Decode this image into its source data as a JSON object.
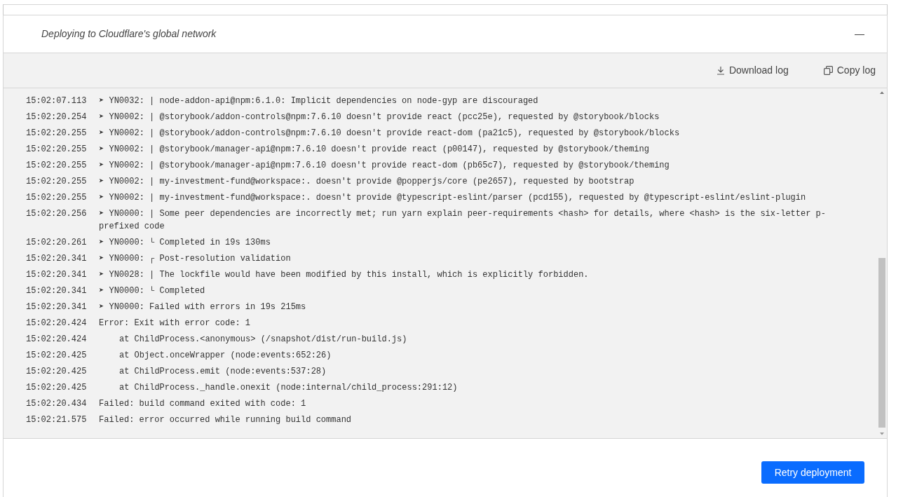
{
  "header": {
    "title": "Deploying to Cloudflare's global network",
    "collapse": "—",
    "expanded": true
  },
  "toolbar": {
    "download": "Download log",
    "copy": "Copy log"
  },
  "log": [
    {
      "time": "15:02:07.113",
      "message": "➤ YN0032: | node-addon-api@npm:6.1.0: Implicit dependencies on node-gyp are discouraged",
      "kind": "line"
    },
    {
      "time": "15:02:20.254",
      "message": "➤ YN0002: | @storybook/addon-controls@npm:7.6.10 doesn't provide react (pcc25e), requested by @storybook/blocks",
      "kind": "line"
    },
    {
      "time": "15:02:20.255",
      "message": "➤ YN0002: | @storybook/addon-controls@npm:7.6.10 doesn't provide react-dom (pa21c5), requested by @storybook/blocks",
      "kind": "line"
    },
    {
      "time": "15:02:20.255",
      "message": "➤ YN0002: | @storybook/manager-api@npm:7.6.10 doesn't provide react (p00147), requested by @storybook/theming",
      "kind": "line"
    },
    {
      "time": "15:02:20.255",
      "message": "➤ YN0002: | @storybook/manager-api@npm:7.6.10 doesn't provide react-dom (pb65c7), requested by @storybook/theming",
      "kind": "line"
    },
    {
      "time": "15:02:20.255",
      "message": "➤ YN0002: | my-investment-fund@workspace:. doesn't provide @popperjs/core (pe2657), requested by bootstrap",
      "kind": "line"
    },
    {
      "time": "15:02:20.255",
      "message": "➤ YN0002: | my-investment-fund@workspace:. doesn't provide @typescript-eslint/parser (pcd155), requested by @typescript-eslint/eslint-plugin",
      "kind": "line"
    },
    {
      "time": "15:02:20.256",
      "message": "➤ YN0000: | Some peer dependencies are incorrectly met; run yarn explain peer-requirements <hash> for details, where <hash> is the six-letter p-prefixed code",
      "kind": "line"
    },
    {
      "time": "15:02:20.261",
      "message": "➤ YN0000: └ Completed in 19s 130ms",
      "kind": "line"
    },
    {
      "time": "15:02:20.341",
      "message": "➤ YN0000: ┌ Post-resolution validation",
      "kind": "line"
    },
    {
      "time": "15:02:20.341",
      "message": "➤ YN0028: | The lockfile would have been modified by this install, which is explicitly forbidden.",
      "kind": "line"
    },
    {
      "time": "15:02:20.341",
      "message": "➤ YN0000: └ Completed",
      "kind": "line"
    },
    {
      "time": "15:02:20.341",
      "message": "➤ YN0000: Failed with errors in 19s 215ms",
      "kind": "line"
    },
    {
      "time": "15:02:20.424",
      "message": "Error: Exit with error code: 1",
      "kind": "line"
    },
    {
      "time": "15:02:20.424",
      "message": "at ChildProcess.<anonymous> (/snapshot/dist/run-build.js)",
      "kind": "stack"
    },
    {
      "time": "15:02:20.425",
      "message": "at Object.onceWrapper (node:events:652:26)",
      "kind": "stack"
    },
    {
      "time": "15:02:20.425",
      "message": "at ChildProcess.emit (node:events:537:28)",
      "kind": "stack"
    },
    {
      "time": "15:02:20.425",
      "message": "at ChildProcess._handle.onexit (node:internal/child_process:291:12)",
      "kind": "stack"
    },
    {
      "time": "15:02:20.434",
      "message": "Failed: build command exited with code: 1",
      "kind": "line"
    },
    {
      "time": "15:02:21.575",
      "message": "Failed: error occurred while running build command",
      "kind": "line"
    }
  ],
  "retry_button": "Retry deployment"
}
